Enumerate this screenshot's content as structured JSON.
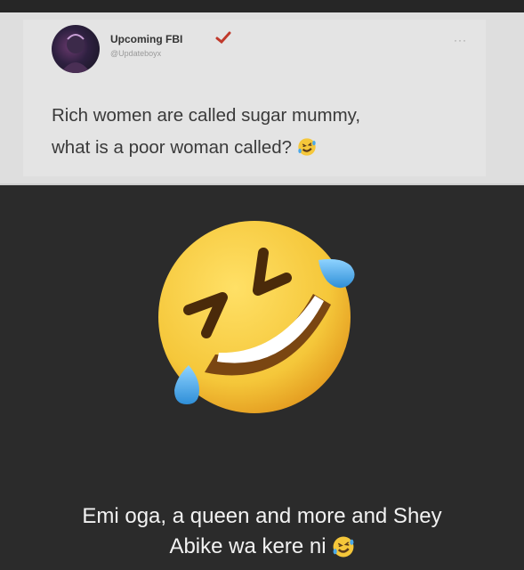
{
  "tweet": {
    "author_name": "Upcoming FBI",
    "author_handle": "@Updateboyx",
    "more_label": "···",
    "text_line1": "Rich women are called sugar mummy,",
    "text_line2": "what is a poor woman called?",
    "verified_icon": "check-icon",
    "trailing_emoji": "rolling-on-floor-laughing-emoji"
  },
  "sticker": {
    "emoji": "rolling-on-floor-laughing-emoji"
  },
  "caption": {
    "line1": "Emi oga, a queen and more and Shey",
    "line2": "Abike wa kere ni",
    "trailing_emoji": "rolling-on-floor-laughing-emoji"
  },
  "colors": {
    "background": "#2b2b2b",
    "card": "#e4e4e4",
    "emoji_face": "#f5c73a",
    "tears": "#4aa8e8"
  }
}
